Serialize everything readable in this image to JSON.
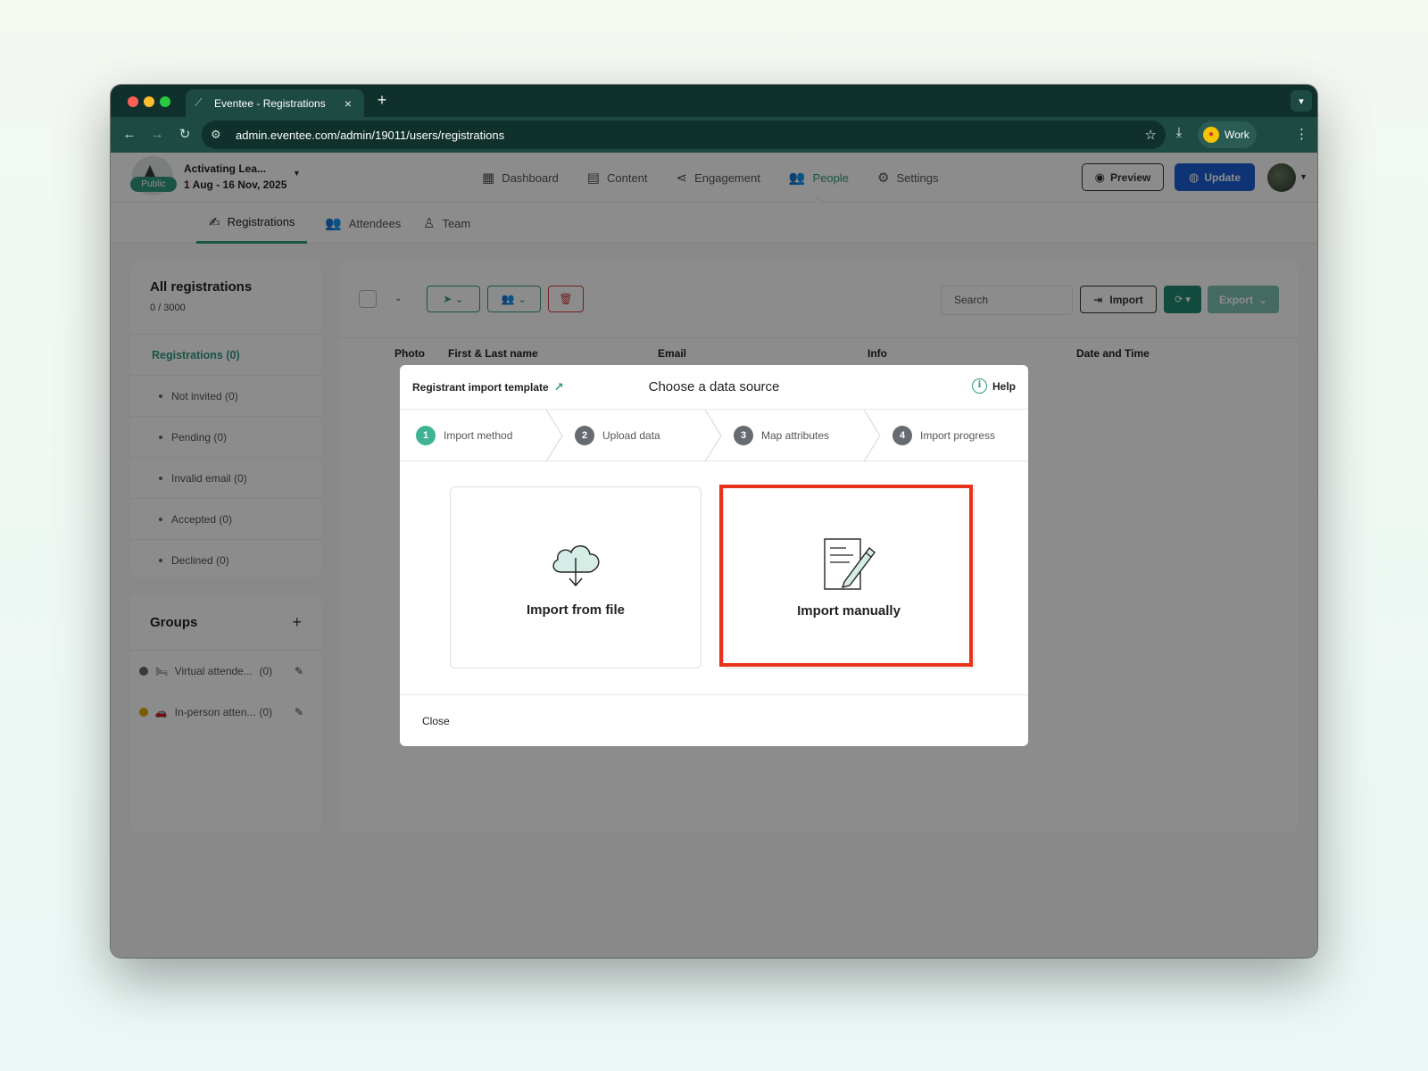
{
  "browser": {
    "tab_title": "Eventee - Registrations",
    "tab_close": "×",
    "new_tab": "+",
    "url": "admin.eventee.com/admin/19011/users/registrations",
    "profile_label": "Work"
  },
  "event": {
    "name": "Activating Lea...",
    "dates": "1 Aug - 16 Nov, 2025",
    "status_badge": "Public"
  },
  "main_nav": [
    {
      "label": "Dashboard",
      "icon": "dashboard-icon"
    },
    {
      "label": "Content",
      "icon": "calendar-icon"
    },
    {
      "label": "Engagement",
      "icon": "share-icon"
    },
    {
      "label": "People",
      "icon": "people-icon",
      "active": true
    },
    {
      "label": "Settings",
      "icon": "gear-icon"
    }
  ],
  "header_actions": {
    "preview": "Preview",
    "update": "Update"
  },
  "sub_nav": [
    {
      "label": "Registrations",
      "active": true
    },
    {
      "label": "Attendees"
    },
    {
      "label": "Team"
    }
  ],
  "left_panel": {
    "title": "All registrations",
    "count": "0 / 3000",
    "filters": [
      "Registrations (0)",
      "Not invited (0)",
      "Pending (0)",
      "Invalid email (0)",
      "Accepted (0)",
      "Declined (0)"
    ],
    "groups_title": "Groups",
    "groups_add": "+",
    "groups": [
      {
        "name": "Virtual attende...",
        "count": "(0)",
        "color": "#6b6b6b",
        "emoji": "🛏"
      },
      {
        "name": "In-person atten...",
        "count": "(0)",
        "color": "#e0a800",
        "emoji": "🚗"
      }
    ]
  },
  "toolbar": {
    "search_placeholder": "Search",
    "import": "Import",
    "export": "Export"
  },
  "table_headers": [
    "Photo",
    "First & Last name",
    "Email",
    "Info",
    "Date and Time"
  ],
  "modal": {
    "template_link": "Registrant import template",
    "title": "Choose a data source",
    "help": "Help",
    "steps": [
      {
        "num": "1",
        "label": "Import method"
      },
      {
        "num": "2",
        "label": "Upload data"
      },
      {
        "num": "3",
        "label": "Map attributes"
      },
      {
        "num": "4",
        "label": "Import progress"
      }
    ],
    "option_file": "Import from file",
    "option_manual": "Import manually",
    "close": "Close"
  },
  "colors": {
    "accent": "#2f9a7f",
    "update_button": "#1b5fd6",
    "highlight": "#e8311a"
  }
}
